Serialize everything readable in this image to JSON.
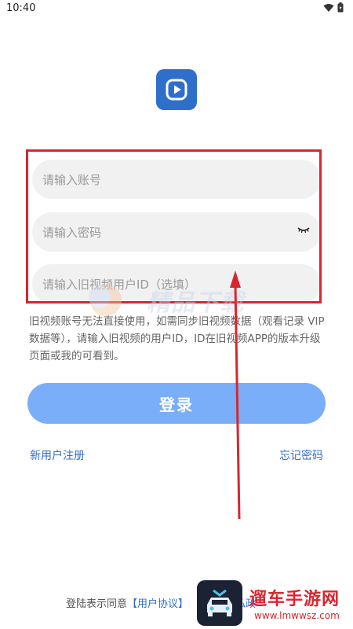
{
  "status_bar": {
    "time": "10:40",
    "icons": [
      "wifi-icon",
      "battery-icon"
    ]
  },
  "logo": {
    "icon": "play-icon",
    "bg_color": "#2f6fcc"
  },
  "form": {
    "account_placeholder": "请输入账号",
    "password_placeholder": "请输入密码",
    "old_id_placeholder": "请输入旧视频用户ID（选填）",
    "password_toggle_icon": "eye-closed-icon",
    "highlight_color": "#d8262f"
  },
  "hint_text": "旧视频账号无法直接使用，如需同步旧视频数据（观看记录 VIP数据等），请输入旧视频的用户ID，ID在旧视频APP的版本升级页面或我的可看到。",
  "login_button": {
    "label": "登录",
    "color": "#7aaef9"
  },
  "links": {
    "register": "新用户注册",
    "forgot_password": "忘记密码"
  },
  "agreement": {
    "prefix": "登陆表示同意",
    "user_agreement": "【用户协议】",
    "privacy_partial": "私政"
  },
  "watermark": {
    "text": "精品下载"
  },
  "site_logo": {
    "name": "遛车手游网",
    "url": "www.lmwwsz.com"
  },
  "accent_color": "#2f6fcc"
}
